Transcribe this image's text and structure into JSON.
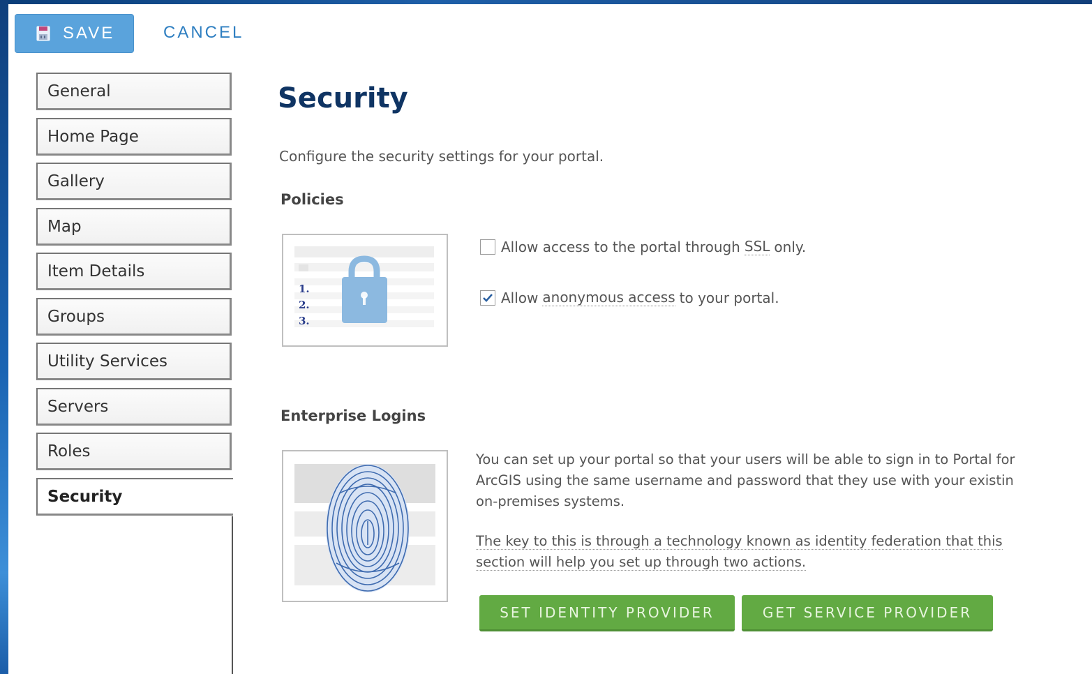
{
  "toolbar": {
    "save_label": "SAVE",
    "save_icon": "floppy-disk-icon",
    "cancel_label": "CANCEL"
  },
  "nav": {
    "items": [
      {
        "label": "General"
      },
      {
        "label": "Home Page"
      },
      {
        "label": "Gallery"
      },
      {
        "label": "Map"
      },
      {
        "label": "Item Details"
      },
      {
        "label": "Groups"
      },
      {
        "label": "Utility Services"
      },
      {
        "label": "Servers"
      },
      {
        "label": "Roles"
      },
      {
        "label": "Security"
      }
    ],
    "active": "Security"
  },
  "main": {
    "title": "Security",
    "description": "Configure the security settings for your portal.",
    "policies": {
      "heading": "Policies",
      "ssl": {
        "checked": false,
        "text_before": "Allow access to the portal through ",
        "text_link": "SSL",
        "text_after": " only."
      },
      "anonymous": {
        "checked": true,
        "text_before": "Allow ",
        "text_link": "anonymous access",
        "text_after": " to your portal."
      },
      "illustration_numbers": [
        "1.",
        "2.",
        "3."
      ]
    },
    "enterprise": {
      "heading": "Enterprise Logins",
      "para1_line1": "You can set up your portal so that your users will be able to sign in to Portal for",
      "para1_line2": "ArcGIS using the same username and password that they use with your existin",
      "para1_line3": "on-premises systems.",
      "para2_line1": "The key to this is through a technology known as identity federation that this",
      "para2_line2": "section will help you set up through two actions.",
      "set_identity_label": "SET IDENTITY PROVIDER",
      "get_service_label": "GET SERVICE PROVIDER"
    }
  },
  "colors": {
    "save_button": "#5aa3dc",
    "cancel_text": "#2f7fc1",
    "title": "#0f3463",
    "green_button": "#62aa43",
    "lock": "#8cb9e0",
    "fingerprint": "#2f5fa8"
  }
}
